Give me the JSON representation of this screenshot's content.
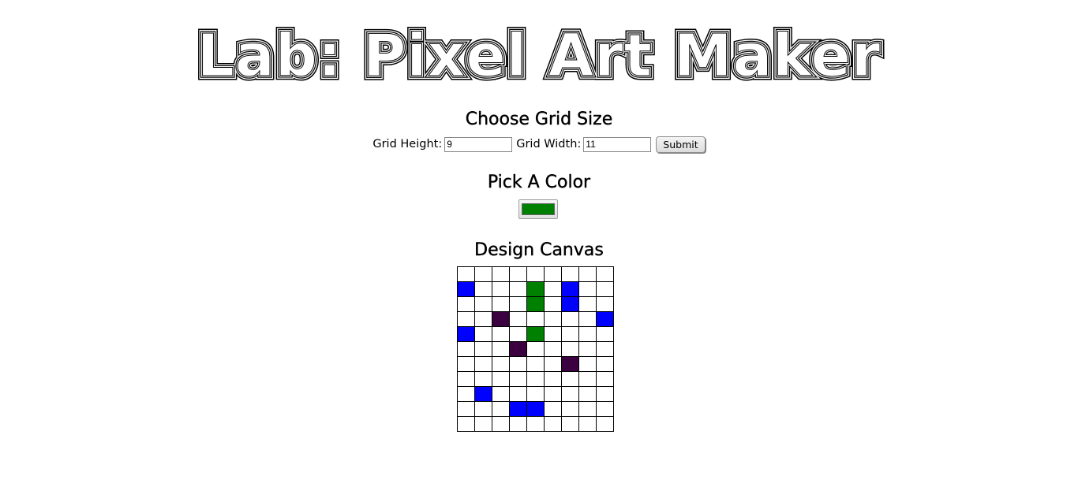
{
  "title": "Lab: Pixel Art Maker",
  "grid_size": {
    "heading": "Choose Grid Size",
    "height_label": "Grid Height:",
    "height_value": "9",
    "width_label": "Grid Width:",
    "width_value": "11",
    "submit_label": "Submit"
  },
  "color": {
    "heading": "Pick A Color",
    "selected_color": "#008000"
  },
  "canvas": {
    "heading": "Design Canvas",
    "rows": 11,
    "cols": 9,
    "palette": {
      "B": "#0000ff",
      "G": "#008000",
      "P": "#3b0040",
      "W": "#ffffff"
    },
    "cells": [
      "WWWWWWWWW",
      "BWWWGWBWW",
      "WWWWGWBWW",
      "WWPWWWWWB",
      "BWWWGWWWW",
      "WWWPWWWWW",
      "WWWWWWPWW",
      "WWWWWWWWW",
      "WBWWWWWWW",
      "WWWBBWWWW",
      "WWWWWWWWW"
    ]
  }
}
